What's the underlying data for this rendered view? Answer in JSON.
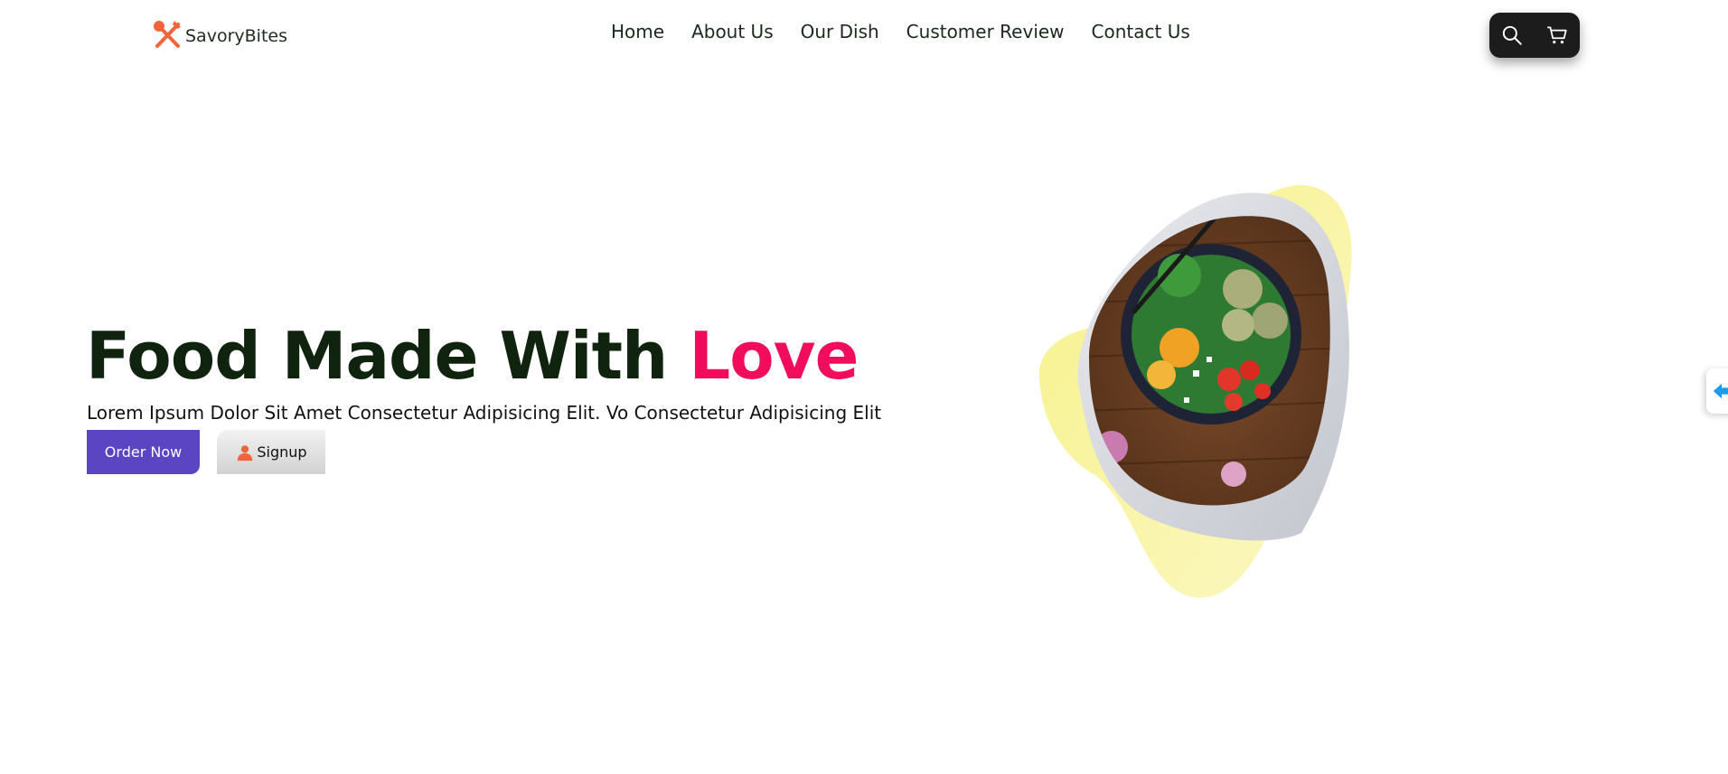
{
  "brand": {
    "name": "SavoryBites",
    "logo_icon": "utensils-icon",
    "logo_color": "#f0663a"
  },
  "nav": {
    "items": [
      {
        "label": "Home"
      },
      {
        "label": "About Us"
      },
      {
        "label": "Our Dish"
      },
      {
        "label": "Customer Review"
      },
      {
        "label": "Contact Us"
      }
    ]
  },
  "toolbar": {
    "search_icon": "search-icon",
    "cart_icon": "cart-icon",
    "background": "#1c1c1c"
  },
  "hero": {
    "title_main": "Food Made With ",
    "title_accent": "Love",
    "subtitle": "Lorem Ipsum Dolor Sit Amet Consectetur Adipisicing Elit. Vo Consectetur Adipisicing Elit",
    "order_button": "Order Now",
    "signup_button": "Signup",
    "signup_icon": "user-icon",
    "image_description": "salad-bowl-image",
    "colors": {
      "title": "#0f230f",
      "accent": "#f20d5c",
      "order_button": "#5b45c2",
      "blob": "#f6f17f"
    }
  },
  "side_tab": {
    "icon": "arrow-left-icon",
    "color": "#1d9be8"
  }
}
